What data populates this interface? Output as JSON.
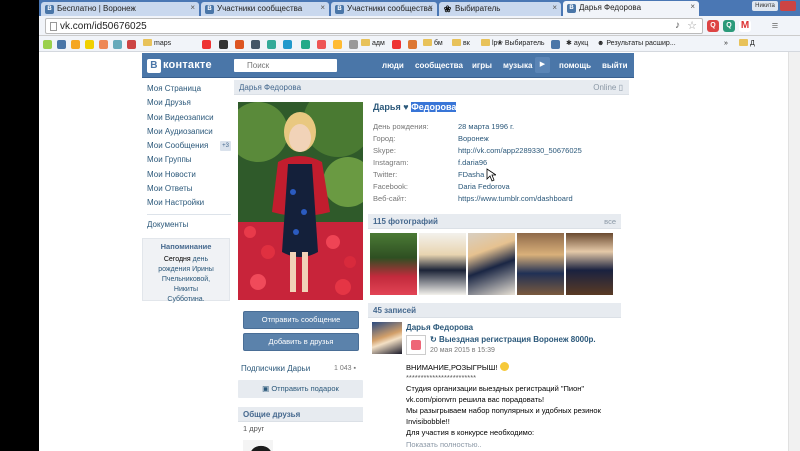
{
  "browser": {
    "tabs": [
      {
        "label": "Бесплатно | Воронеж",
        "favicon": "vk-icon"
      },
      {
        "label": "Участники сообщества",
        "favicon": "vk-icon"
      },
      {
        "label": "Участники сообщества",
        "favicon": "vk-icon"
      },
      {
        "label": "Выбиратель",
        "favicon": "paw-icon"
      },
      {
        "label": "Дарья Федорова",
        "favicon": "vk-icon"
      }
    ],
    "window_user": "Никита",
    "address": "vk.com/id50676025",
    "bookmarks": {
      "maps": "maps",
      "adm": "адм",
      "bm": "бм",
      "vk": "вк",
      "lp": "lp",
      "chooser": "Выбиратель",
      "auction": "аукц",
      "search_results": "Результаты расшир...",
      "more": "»",
      "other": "Д"
    }
  },
  "vk": {
    "logo_text": "контакте",
    "logo_letter": "В",
    "search_placeholder": "Поиск",
    "nav": {
      "people": "люди",
      "communities": "сообщества",
      "games": "игры",
      "music": "музыка",
      "help": "помощь",
      "logout": "выйти"
    },
    "menu": [
      {
        "label": "Моя Страница"
      },
      {
        "label": "Мои Друзья"
      },
      {
        "label": "Мои Видеозаписи"
      },
      {
        "label": "Мои Аудиозаписи"
      },
      {
        "label": "Мои Сообщения",
        "badge": "+3"
      },
      {
        "label": "Мои Группы"
      },
      {
        "label": "Мои Новости"
      },
      {
        "label": "Мои Ответы"
      },
      {
        "label": "Мои Настройки"
      }
    ],
    "documents": "Документы",
    "reminder": {
      "title": "Напоминание",
      "line1": "Сегодня",
      "line1b": "день",
      "line2": "рождения",
      "line2b": "Ирины",
      "line3": "Пчельниковой,",
      "line4": "Никиты",
      "line5": "Субботина."
    },
    "profile": {
      "header_name": "Дарья Федорова",
      "online": "Online",
      "first_name": "Дарья",
      "last_name": "Федорова",
      "info": [
        {
          "k": "День рождения:",
          "v": "28 марта 1996 г.",
          "plain": false
        },
        {
          "k": "Город:",
          "v": "Воронеж",
          "plain": false
        },
        {
          "k": "Skype:",
          "v": "http://vk.com/app2289330_50676025",
          "plain": false
        },
        {
          "k": "Instagram:",
          "v": "f.daria96",
          "plain": false
        },
        {
          "k": "Twitter:",
          "v": "FDasha",
          "plain": false
        },
        {
          "k": "Facebook:",
          "v": "Daria Fedorova",
          "plain": false
        },
        {
          "k": "Веб-сайт:",
          "v": "https://www.tumblr.com/dashboard",
          "plain": false
        }
      ],
      "send_message": "Отправить сообщение",
      "add_friend": "Добавить в друзья",
      "subscribers_label": "Подписчики Дарьи",
      "subscribers_count": "1 043",
      "send_gift": "Отправить подарок",
      "common_friends": "Общие друзья",
      "common_friends_count": "1 друг",
      "photos_title": "115 фотографий",
      "photos_all": "все",
      "posts_title": "45 записей"
    },
    "post": {
      "author": "Дарья Федорова",
      "repost_title": "Выездная регистрация Воронеж 8000р.",
      "repost_date": "20 мая 2015 в 15:39",
      "lines": [
        "ВНИМАНИЕ,РОЗЫГРЫШ!",
        "************************",
        "Студия организации выездных регистраций \"Пион\"",
        "vk.com/pionvrn решила вас порадовать!",
        "Мы разыгрываем набор популярных и удобных резинок",
        "Invisibobble!!",
        "Для участия в конкурсе необходимо:"
      ],
      "show_more": "Показать полностью.."
    }
  }
}
